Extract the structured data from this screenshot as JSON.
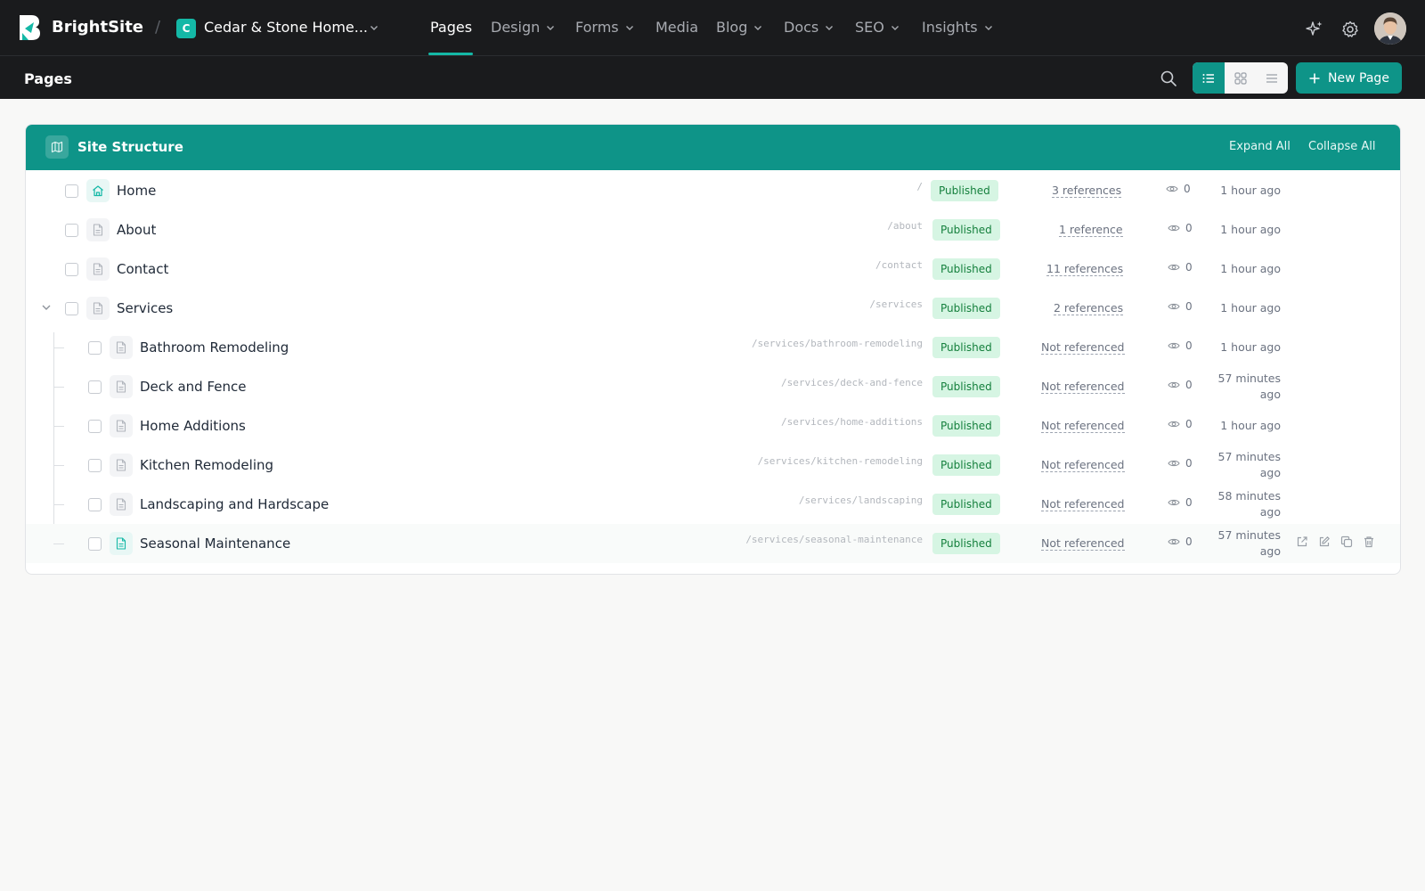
{
  "app": {
    "brand": "BrightSite",
    "separator": "/",
    "site_initial": "C",
    "site_name": "Cedar & Stone Home...",
    "nav": [
      {
        "label": "Pages",
        "active": true,
        "dropdown": false
      },
      {
        "label": "Design",
        "dropdown": true
      },
      {
        "label": "Forms",
        "dropdown": true
      },
      {
        "label": "Media",
        "dropdown": false
      },
      {
        "label": "Blog",
        "dropdown": true
      },
      {
        "label": "Docs",
        "dropdown": true
      },
      {
        "label": "SEO",
        "dropdown": true
      },
      {
        "label": "Insights",
        "dropdown": true
      }
    ],
    "icons": {
      "ai": "sparkles-icon",
      "settings": "gear-icon",
      "user": "avatar"
    }
  },
  "toolbar": {
    "title": "Pages",
    "views": [
      "list-view",
      "grid-view",
      "compact-view"
    ],
    "active_view": "list-view",
    "new_page_label": "New Page"
  },
  "structure": {
    "title": "Site Structure",
    "expand_all": "Expand All",
    "collapse_all": "Collapse All",
    "rows": [
      {
        "name": "Home",
        "path": "/",
        "status": "Published",
        "refs": "3 references",
        "views": "0",
        "updated": "1 hour ago",
        "icon": "home-icon"
      },
      {
        "name": "About",
        "path": "/about",
        "status": "Published",
        "refs": "1 reference",
        "views": "0",
        "updated": "1 hour ago",
        "icon": "document-icon"
      },
      {
        "name": "Contact",
        "path": "/contact",
        "status": "Published",
        "refs": "11 references",
        "views": "0",
        "updated": "1 hour ago",
        "icon": "document-icon"
      },
      {
        "name": "Services",
        "path": "/services",
        "status": "Published",
        "refs": "2 references",
        "views": "0",
        "updated": "1 hour ago",
        "icon": "document-icon",
        "expanded": true
      },
      {
        "name": "Bathroom Remodeling",
        "path": "/services/bathroom-remodeling",
        "status": "Published",
        "refs": "Not referenced",
        "views": "0",
        "updated": "1 hour ago",
        "icon": "document-icon"
      },
      {
        "name": "Deck and Fence",
        "path": "/services/deck-and-fence",
        "status": "Published",
        "refs": "Not referenced",
        "views": "0",
        "updated": "57 minutes ago",
        "updated_lines": [
          "57 minutes",
          "ago"
        ],
        "icon": "document-icon"
      },
      {
        "name": "Home Additions",
        "path": "/services/home-additions",
        "status": "Published",
        "refs": "Not referenced",
        "views": "0",
        "updated": "1 hour ago",
        "icon": "document-icon"
      },
      {
        "name": "Kitchen Remodeling",
        "path": "/services/kitchen-remodeling",
        "status": "Published",
        "refs": "Not referenced",
        "views": "0",
        "updated": "57 minutes ago",
        "updated_lines": [
          "57 minutes",
          "ago"
        ],
        "icon": "document-icon"
      },
      {
        "name": "Landscaping and Hardscape",
        "path": "/services/landscaping",
        "status": "Published",
        "refs": "Not referenced",
        "views": "0",
        "updated": "58 minutes ago",
        "updated_lines": [
          "58 minutes",
          "ago"
        ],
        "icon": "document-icon"
      },
      {
        "name": "Seasonal Maintenance",
        "path": "/services/seasonal-maintenance",
        "status": "Published",
        "refs": "Not referenced",
        "views": "0",
        "updated": "57 minutes ago",
        "updated_lines": [
          "57 minutes",
          "ago"
        ],
        "icon": "document-icon",
        "hovered": true
      }
    ],
    "row_actions": [
      "open-external-icon",
      "edit-icon",
      "duplicate-icon",
      "trash-icon"
    ]
  },
  "colors": {
    "accent": "#0e9488",
    "topbar": "#1a1b1d",
    "published_bg": "#d6f5e3",
    "published_text": "#15803d"
  }
}
